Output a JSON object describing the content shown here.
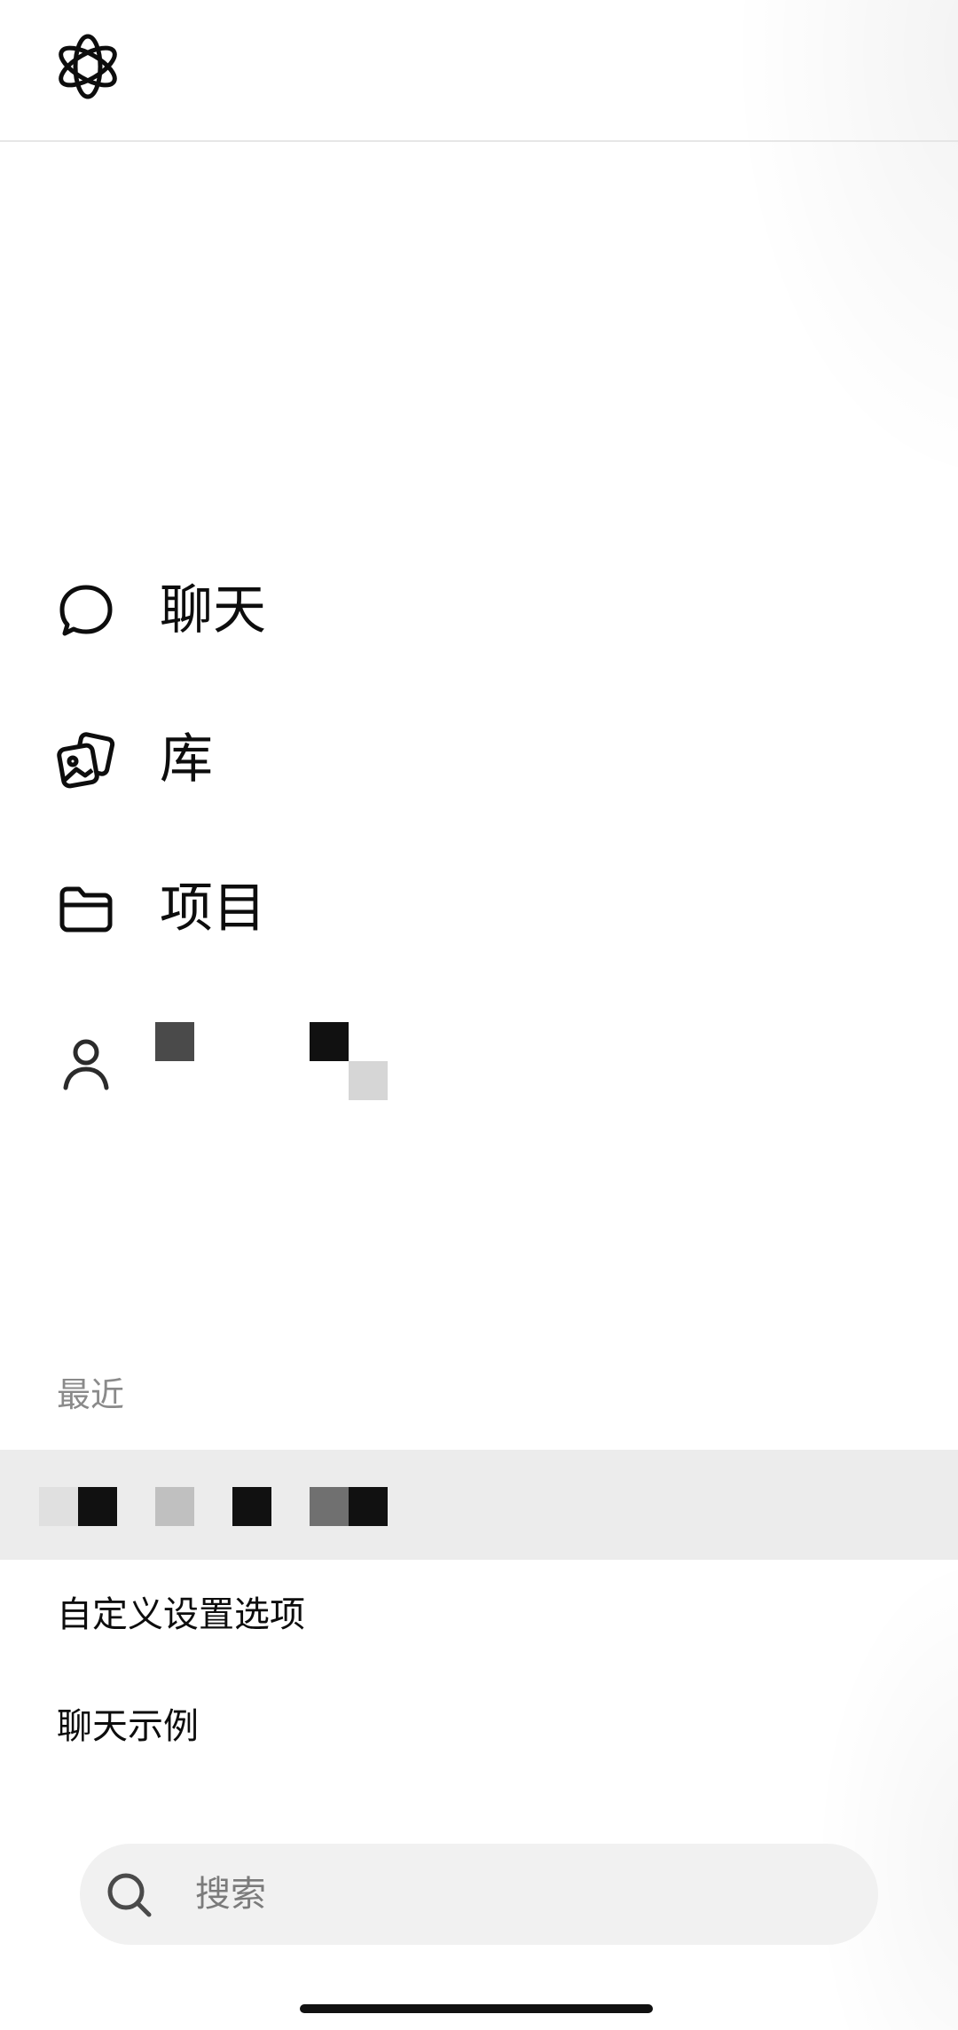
{
  "nav": {
    "items": [
      {
        "label": "聊天",
        "icon": "chat-bubble-icon"
      },
      {
        "label": "库",
        "icon": "gallery-icon"
      },
      {
        "label": "项目",
        "icon": "folder-icon"
      },
      {
        "label": "",
        "icon": "person-icon"
      }
    ]
  },
  "recent": {
    "title": "最近"
  },
  "menu": {
    "customize": "自定义设置选项",
    "examples": "聊天示例"
  },
  "search": {
    "placeholder": "搜索"
  }
}
